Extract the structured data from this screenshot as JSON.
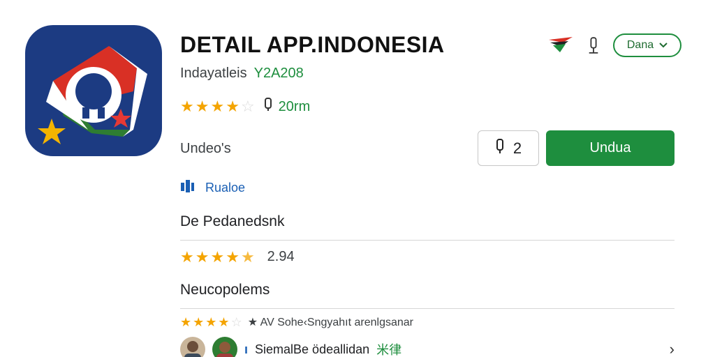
{
  "app": {
    "title": "DETAIL APP.INDONESIA",
    "developer": "Indayatleis",
    "version_code": "Y2A208",
    "rating_stars": 4.5,
    "downloads": "20rm",
    "status_label": "Undeo's",
    "install_count": "2",
    "install_label": "Undua",
    "link_label": "Rualoe",
    "language_button": "Dana"
  },
  "sections": {
    "ratings_title": "De Pedanedsnk",
    "ratings_value": "2.94",
    "ratings_stars": 4.5,
    "reviews_title": "Neucopolems",
    "review_line": "★ AV Sohe‹Sngyahıt arenlgsanar",
    "review_stars": 4.5,
    "user_label": "SiemalBe ödeallidan",
    "user_suffix": "米律"
  },
  "icons": {
    "flag": "flag-icon",
    "pin": "pin-icon",
    "download": "download-icon",
    "chevron_down": "chevron-down-icon",
    "chevron_right": "chevron-right-icon",
    "link": "building-icon"
  },
  "colors": {
    "accent_green": "#1e8e3e",
    "icon_bg": "#1c3b82",
    "star": "#f4a400",
    "link_blue": "#1a5fb4"
  }
}
